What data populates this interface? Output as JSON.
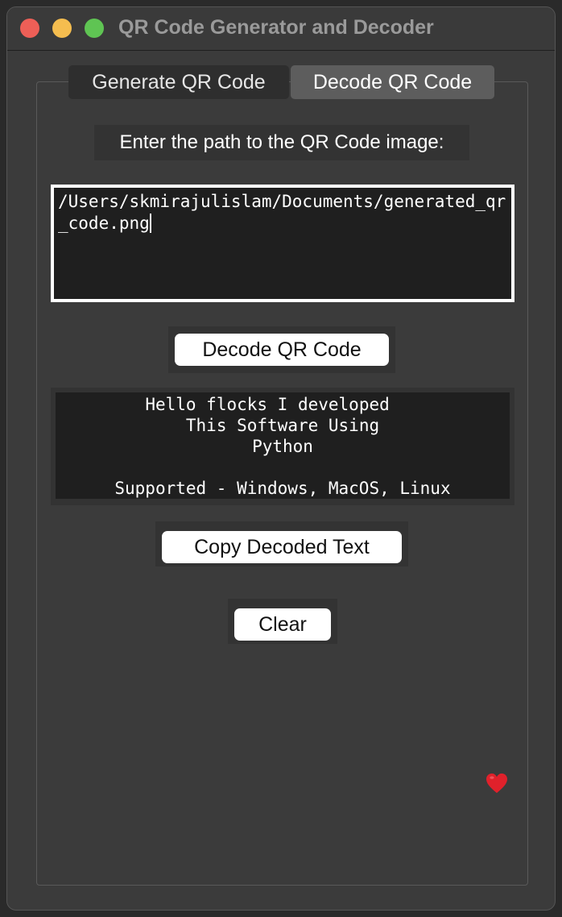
{
  "window": {
    "title": "QR Code Generator and Decoder"
  },
  "tabs": [
    {
      "label": "Generate QR Code",
      "selected": false
    },
    {
      "label": "Decode QR Code",
      "selected": true
    }
  ],
  "decode": {
    "prompt_label": "Enter the path to the QR Code image:",
    "path_value": "/Users/skmirajulislam/Documents/generated_qr_code.png",
    "decode_button_label": "Decode QR Code",
    "result_lines": [
      "Hello flocks I developed   ",
      "This Software Using",
      "Python",
      "",
      "Supported - Windows, MacOS, Linux"
    ],
    "result_icon": "heart-icon",
    "copy_button_label": "Copy Decoded Text",
    "clear_button_label": "Clear"
  },
  "colors": {
    "close": "#ed5f57",
    "minimize": "#f5bd4f",
    "maximize": "#5fc453",
    "heart": "#e0212b"
  }
}
